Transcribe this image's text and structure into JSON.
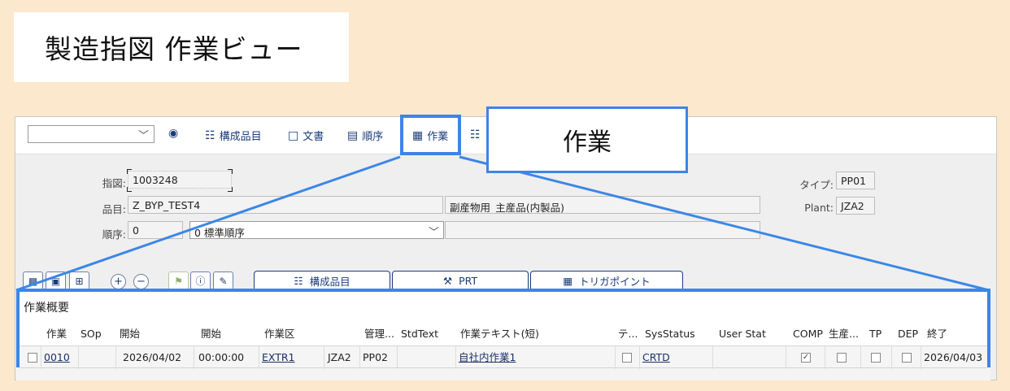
{
  "slide_title": "製造指図 作業ビュー",
  "callout": "作業",
  "toolbar": {
    "select_value": "",
    "buttons": [
      {
        "label": "構成品目",
        "icon": "hierarchy-icon"
      },
      {
        "label": "文書",
        "icon": "document-icon"
      },
      {
        "label": "順序",
        "icon": "sequence-icon"
      },
      {
        "label": "作業",
        "icon": "operation-icon"
      }
    ]
  },
  "header": {
    "order_label": "指図:",
    "order_value": "1003248",
    "material_label": "品目:",
    "material_value": "Z_BYP_TEST4",
    "material_desc": "副産物用_主産品(内製品)",
    "sequence_label": "順序:",
    "sequence_value": "0",
    "sequence_select": "0 標準順序",
    "type_label": "タイプ:",
    "type_value": "PP01",
    "plant_label": "Plant:",
    "plant_value": "JZA2"
  },
  "action_buttons": {
    "components": "構成品目",
    "prt": "PRT",
    "trigger": "トリガポイント"
  },
  "table": {
    "title": "作業概要",
    "columns": [
      "作業",
      "SOp",
      "開始",
      "開始",
      "作業区",
      "",
      "管理...",
      "StdText",
      "作業テキスト(短)",
      "テ...",
      "SysStatus",
      "User Stat",
      "COMP",
      "生産...",
      "TP",
      "DEP",
      "終了"
    ],
    "rows": [
      {
        "op": "0010",
        "sop": "",
        "start_date": "2026/04/02",
        "start_time": "00:00:00",
        "work_center": "EXTR1",
        "plant": "JZA2",
        "control": "PP02",
        "std_text": "",
        "text": "自社内作業1",
        "sys_status": "CRTD",
        "user_status": "",
        "comp": true,
        "end": "2026/04/03"
      }
    ]
  },
  "colors": {
    "accent": "#3b86e8",
    "background": "#fce8cc",
    "sap_blue": "#1b3c7a"
  }
}
